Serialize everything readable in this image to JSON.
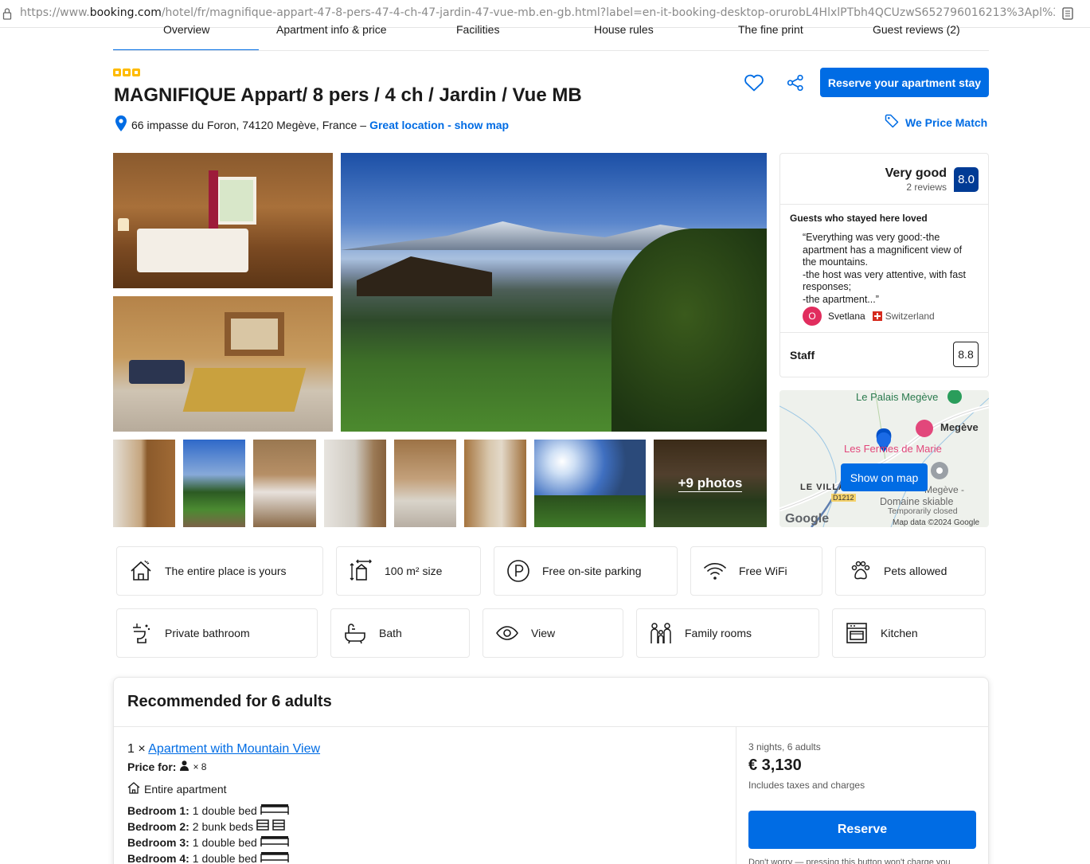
{
  "browser": {
    "url_prefix": "https://www.",
    "url_domain": "booking.com",
    "url_rest": "/hotel/fr/magnifique-appart-47-8-pers-47-4-ch-47-jardin-47-vue-mb.en-gb.html?label=en-it-booking-desktop-orurobL4HlxlPTbh4QCUzwS652796016213%3Apl%3Ata%3Ap1%"
  },
  "tabs": [
    "Overview",
    "Apartment info & price",
    "Facilities",
    "House rules",
    "The fine print",
    "Guest reviews (2)"
  ],
  "property": {
    "title": "MAGNIFIQUE Appart/ 8 pers / 4 ch / Jardin / Vue MB",
    "address": "66 impasse du Foron, 74120 Megève, France",
    "dash": "–",
    "location_link": "Great location - show map",
    "reserve_button": "Reserve your apartment stay",
    "price_match": "We Price Match",
    "star_count": 3
  },
  "photos": {
    "more_label": "+9 photos"
  },
  "reviews": {
    "rating_word": "Very good",
    "review_count": "2 reviews",
    "score": "8.0",
    "loved_heading": "Guests who stayed here loved",
    "quote": "“Everything was very good:-the apartment has a magnificent view of the mountains.\n-the host was very attentive, with fast responses;\n-the apartment...”",
    "author_initial": "O",
    "author_name": "Svetlana",
    "author_country": "Switzerland",
    "staff_label": "Staff",
    "staff_score": "8.8"
  },
  "map": {
    "button": "Show on map",
    "labels": {
      "palais": "Le Palais Megève",
      "megeve": "Megève",
      "fermes": "Les Fermes de Marie",
      "villard": "LE VILLA",
      "megeve_domaine_1": "Megève -",
      "domaine": "Domaine skiable",
      "closed": "Temporarily closed",
      "road": "D1212",
      "google": "Google",
      "mapdata": "Map data ©2024 Google"
    }
  },
  "facilities": [
    {
      "label": "The entire place is yours",
      "icon": "house-icon"
    },
    {
      "label": "100 m² size",
      "icon": "size-icon"
    },
    {
      "label": "Free on-site parking",
      "icon": "parking-icon"
    },
    {
      "label": "Free WiFi",
      "icon": "wifi-icon"
    },
    {
      "label": "Pets allowed",
      "icon": "paw-icon"
    },
    {
      "label": "Private bathroom",
      "icon": "toilet-icon"
    },
    {
      "label": "Bath",
      "icon": "bath-icon"
    },
    {
      "label": "View",
      "icon": "eye-icon"
    },
    {
      "label": "Family rooms",
      "icon": "family-icon"
    },
    {
      "label": "Kitchen",
      "icon": "kitchen-icon"
    }
  ],
  "recommended": {
    "title": "Recommended for 6 adults",
    "unit_count": "1 ×",
    "unit_name": "Apartment with Mountain View",
    "price_for_label": "Price for:",
    "price_for_mult": "× 8",
    "entire_apartment": "Entire apartment",
    "bedrooms": [
      {
        "label": "Bedroom 1:",
        "beds": "1 double bed",
        "type": "double"
      },
      {
        "label": "Bedroom 2:",
        "beds": "2 bunk beds",
        "type": "bunk"
      },
      {
        "label": "Bedroom 3:",
        "beds": "1 double bed",
        "type": "double"
      },
      {
        "label": "Bedroom 4:",
        "beds": "1 double bed",
        "type": "double"
      }
    ],
    "nights": "3 nights, 6 adults",
    "price": "€ 3,130",
    "taxes": "Includes taxes and charges",
    "reserve": "Reserve",
    "worry": "Don't worry — pressing this button won't charge you"
  },
  "colors": {
    "brand_blue": "#006ce4",
    "score_navy": "#003b95",
    "star_yellow": "#febb02"
  }
}
